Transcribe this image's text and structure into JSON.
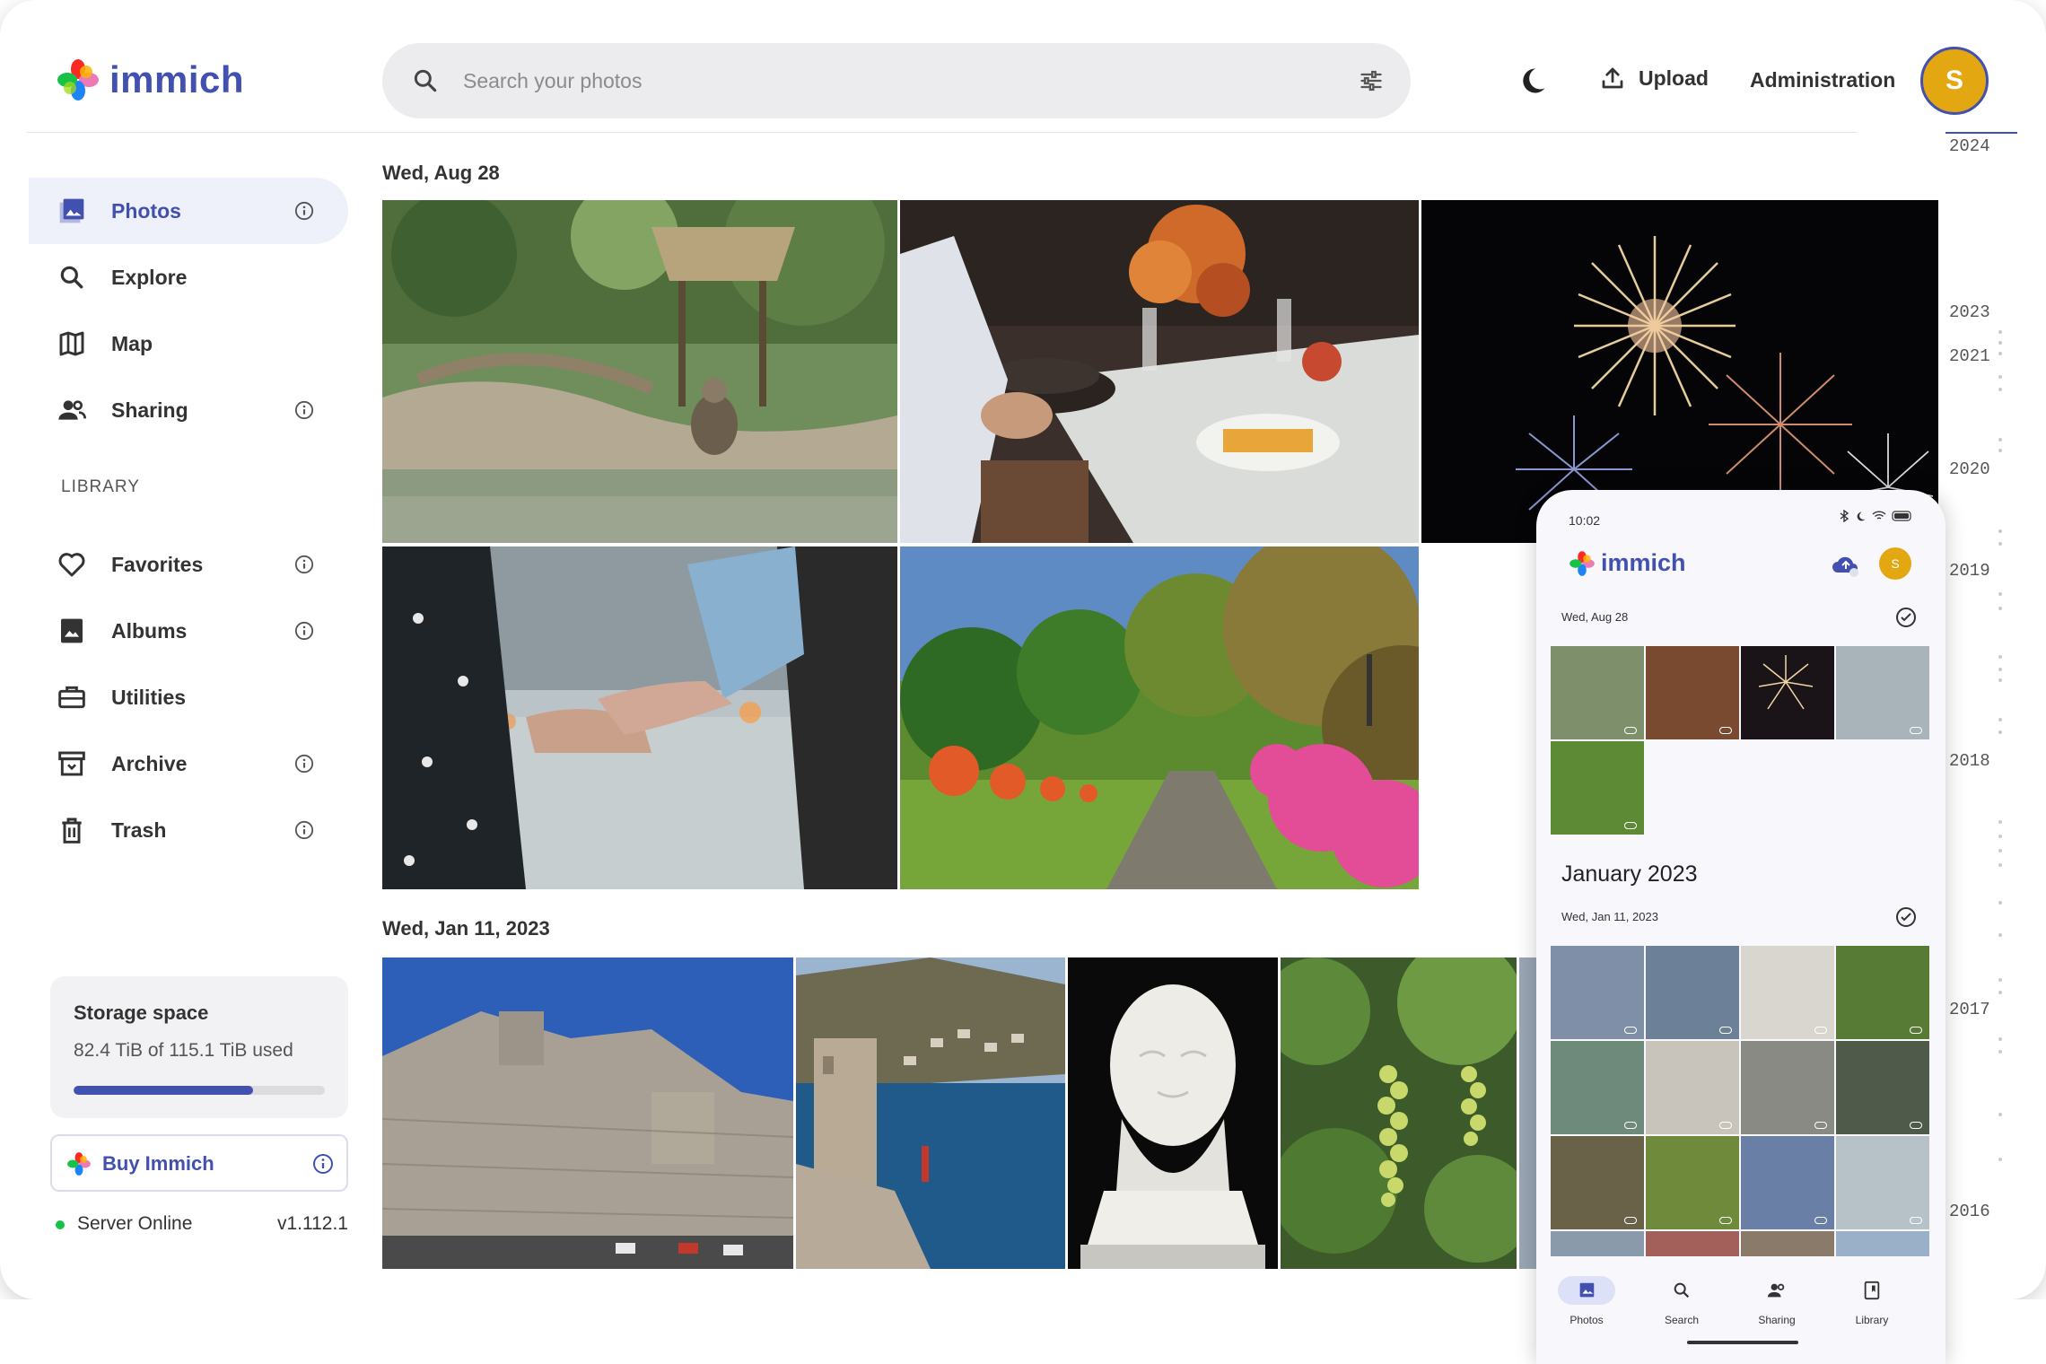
{
  "app": {
    "name": "immich",
    "brand_color": "#4250af"
  },
  "header": {
    "search_placeholder": "Search your photos",
    "upload_label": "Upload",
    "admin_label": "Administration",
    "avatar_letter": "S"
  },
  "sidebar": {
    "items": [
      {
        "label": "Photos",
        "icon": "photos-icon",
        "active": true,
        "info": true
      },
      {
        "label": "Explore",
        "icon": "search-icon",
        "info": false
      },
      {
        "label": "Map",
        "icon": "map-icon",
        "info": false
      },
      {
        "label": "Sharing",
        "icon": "people-icon",
        "info": true
      }
    ],
    "library_label": "LIBRARY",
    "library_items": [
      {
        "label": "Favorites",
        "icon": "heart-icon",
        "info": true
      },
      {
        "label": "Albums",
        "icon": "album-icon",
        "info": true
      },
      {
        "label": "Utilities",
        "icon": "toolbox-icon",
        "info": false
      },
      {
        "label": "Archive",
        "icon": "archive-icon",
        "info": true
      },
      {
        "label": "Trash",
        "icon": "trash-icon",
        "info": true
      }
    ],
    "storage": {
      "title": "Storage space",
      "usage": "82.4 TiB of 115.1 TiB used",
      "percent": 71.6
    },
    "buy_label": "Buy Immich",
    "server_status": "Server Online",
    "server_version": "v1.112.1"
  },
  "timeline": {
    "groups": [
      {
        "date": "Wed, Aug 28"
      },
      {
        "date": "Wed, Jan 11, 2023"
      }
    ],
    "photo_subjects": [
      "monkeys-enclosure",
      "dinner-table",
      "fireworks",
      "holding-hands",
      "garden-path",
      "fortress-walls",
      "coastal-town",
      "bust-sculpture",
      "sea-grapes"
    ]
  },
  "scrubber": {
    "years": [
      "2024",
      "2023",
      "2021",
      "2020",
      "2019",
      "2018",
      "2017",
      "2016"
    ]
  },
  "phone": {
    "time": "10:02",
    "app_name": "immich",
    "avatar_letter": "S",
    "group1_date": "Wed, Aug 28",
    "month_title": "January 2023",
    "group2_date": "Wed, Jan 11, 2023",
    "nav": [
      "Photos",
      "Search",
      "Sharing",
      "Library"
    ]
  }
}
